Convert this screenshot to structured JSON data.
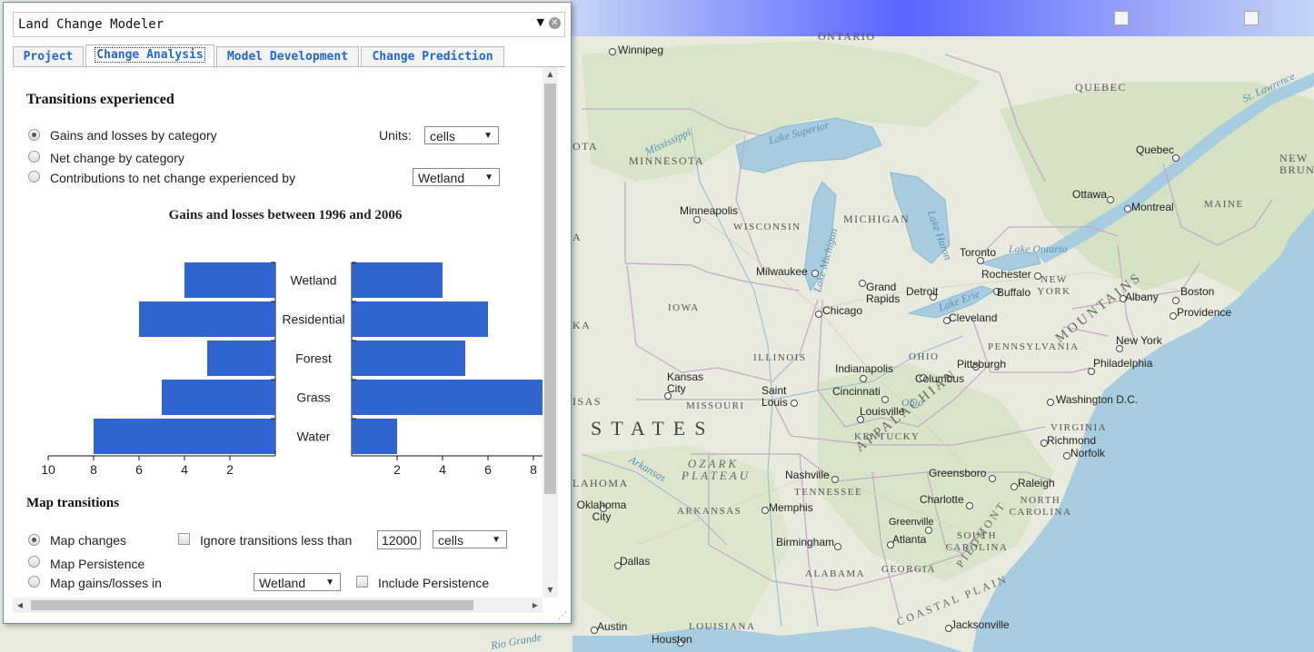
{
  "map": {
    "states": [
      "MINNESOTA",
      "WISCONSIN",
      "MICHIGAN",
      "IOWA",
      "ILLINOIS",
      "OHIO",
      "PENNSYLVANIA",
      "MISSOURI",
      "KENTUCKY",
      "TENNESSEE",
      "ARKANSAS",
      "VIRGINIA",
      "NORTH CAROLINA",
      "SOUTH CAROLINA",
      "GEORGIA",
      "ALABAMA",
      "LOUISIANA",
      "MAINE",
      "NEW YORK",
      "QUEBEC",
      "NEW BRUNSWICK",
      "ONTARIO"
    ],
    "cities": [
      "Winnipeg",
      "Minneapolis",
      "Milwaukee",
      "Chicago",
      "Grand Rapids",
      "Detroit",
      "Toronto",
      "Rochester",
      "Buffalo",
      "Cleveland",
      "Pittsburgh",
      "Columbus",
      "Indianapolis",
      "Cincinnati",
      "Louisville",
      "Saint Louis",
      "Kansas City",
      "Nashville",
      "Memphis",
      "Birmingham",
      "Atlanta",
      "Greenville",
      "Charlotte",
      "Greensboro",
      "Raleigh",
      "Richmond",
      "Norfolk",
      "Washington D.C.",
      "Philadelphia",
      "New York",
      "Boston",
      "Providence",
      "Albany",
      "Montreal",
      "Ottawa",
      "Quebec",
      "Dallas",
      "Oklahoma City",
      "Austin",
      "Houston",
      "Jacksonville"
    ],
    "regions": [
      "OZARK PLATEAU",
      "APPALACHIAN",
      "MOUNTAINS",
      "PIEDMONT",
      "COASTAL PLAIN",
      "STATES"
    ],
    "water": [
      "Lake Superior",
      "Lake Michigan",
      "Lake Huron",
      "Lake Erie",
      "Lake Ontario",
      "Mississippi",
      "Ohio",
      "St. Lawrence",
      "Arkansas",
      "Rio Grande"
    ],
    "edge_text": [
      "OTA",
      "A",
      "KA",
      "ISAS",
      "LAHOMA"
    ]
  },
  "dialog": {
    "title": "Land Change Modeler",
    "tabs": [
      "Project",
      "Change Analysis",
      "Model Development",
      "Change Prediction"
    ],
    "active_tab": "Change Analysis"
  },
  "transitions": {
    "heading": "Transitions experienced",
    "options": [
      "Gains and losses by category",
      "Net change by category",
      "Contributions to net change experienced by"
    ],
    "selected": 0,
    "units_label": "Units:",
    "units_value": "cells",
    "contrib_value": "Wetland"
  },
  "chart_data": {
    "type": "bar",
    "title": "Gains and losses between 1996 and 2006",
    "categories": [
      "Wetland",
      "Residential",
      "Forest",
      "Grass",
      "Water"
    ],
    "series": [
      {
        "name": "losses",
        "values": [
          4,
          6,
          3,
          5,
          8
        ]
      },
      {
        "name": "gains",
        "values": [
          4,
          6,
          5,
          8.5,
          2
        ]
      }
    ],
    "left_axis": {
      "ticks": [
        "10",
        "8",
        "6",
        "4",
        "2"
      ],
      "range": [
        10,
        0
      ]
    },
    "right_axis": {
      "ticks": [
        "2",
        "4",
        "6",
        "8"
      ],
      "range": [
        0,
        8.5
      ]
    },
    "bar_color": "#3065d0"
  },
  "map_transitions": {
    "heading": "Map transitions",
    "options": [
      "Map changes",
      "Map Persistence",
      "Map gains/losses in"
    ],
    "selected": 0,
    "ignore_label": "Ignore transitions less than",
    "ignore_value": "12000",
    "ignore_units": "cells",
    "gains_category": "Wetland",
    "include_persistence_label": "Include Persistence"
  },
  "colors": {
    "tab_text": "#2266cc",
    "accent_bar": "#5b63ff",
    "water": "#a9cde0",
    "land": "#e9ebdf"
  }
}
